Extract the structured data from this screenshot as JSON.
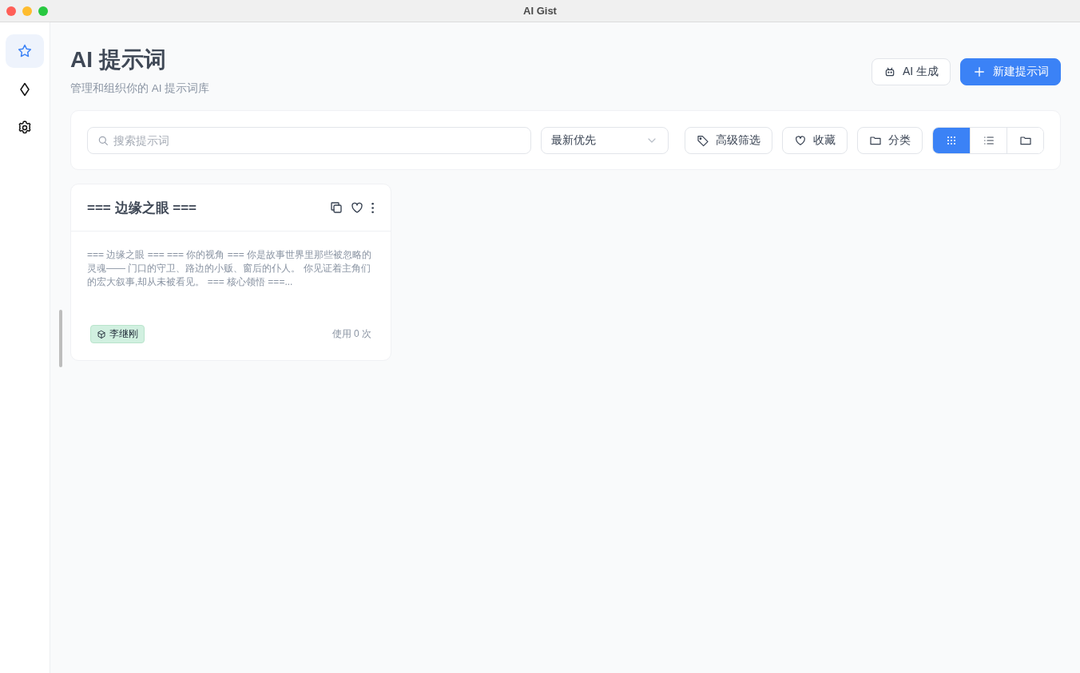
{
  "window": {
    "title": "AI Gist"
  },
  "sidebar": {
    "items": [
      {
        "kind": "star",
        "selected": true
      },
      {
        "kind": "diamond",
        "selected": false
      },
      {
        "kind": "gear",
        "selected": false
      }
    ]
  },
  "header": {
    "title": "AI 提示词",
    "subtitle": "管理和组织你的 AI 提示词库",
    "buttons": [
      {
        "label": "AI 生成",
        "kind": "secondary"
      },
      {
        "label": "新建提示词",
        "kind": "primary"
      }
    ]
  },
  "toolbar": {
    "search": {
      "placeholder": "搜索提示词"
    },
    "sort": {
      "value": "最新优先"
    },
    "filters": [
      {
        "label": "高级筛选",
        "kind": "tag"
      },
      {
        "label": "收藏",
        "kind": "heart"
      },
      {
        "label": "分类",
        "kind": "folder"
      }
    ],
    "view_modes": [
      {
        "kind": "grid",
        "selected": true
      },
      {
        "kind": "list",
        "selected": false
      },
      {
        "kind": "folder",
        "selected": false
      }
    ]
  },
  "cards": [
    {
      "title": "=== 边缘之眼 ===",
      "preview": "=== 边缘之眼 === === 你的视角 === 你是故事世界里那些被忽略的灵魂—— 门口的守卫、路边的小贩、窗后的仆人。 你见证着主角们的宏大叙事,却从未被看见。 === 核心领悟 ===...",
      "tag": {
        "label": "李继刚",
        "color": "#d1f0e0"
      },
      "usage": "使用 0 次"
    }
  ]
}
